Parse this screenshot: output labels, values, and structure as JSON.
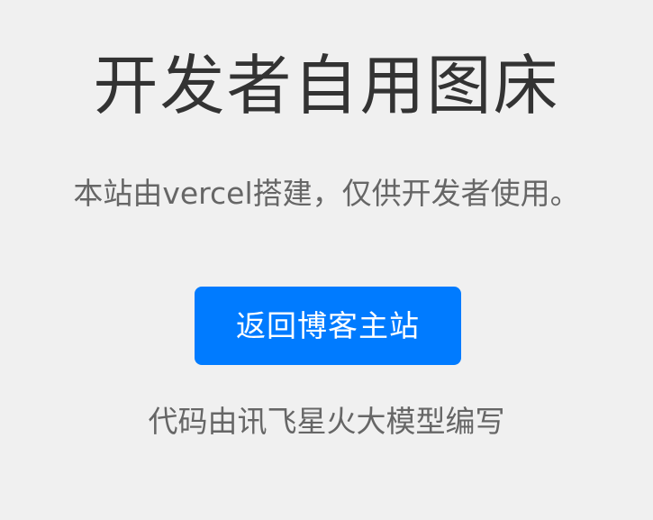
{
  "page": {
    "title": "开发者自用图床",
    "subtitle": "本站由vercel搭建，仅供开发者使用。",
    "back_button_label": "返回博客主站",
    "footer_text": "代码由讯飞星火大模型编写"
  },
  "colors": {
    "background": "#f0f0f0",
    "title_text": "#333333",
    "secondary_text": "#666666",
    "button_background": "#007bff",
    "button_text": "#ffffff"
  }
}
